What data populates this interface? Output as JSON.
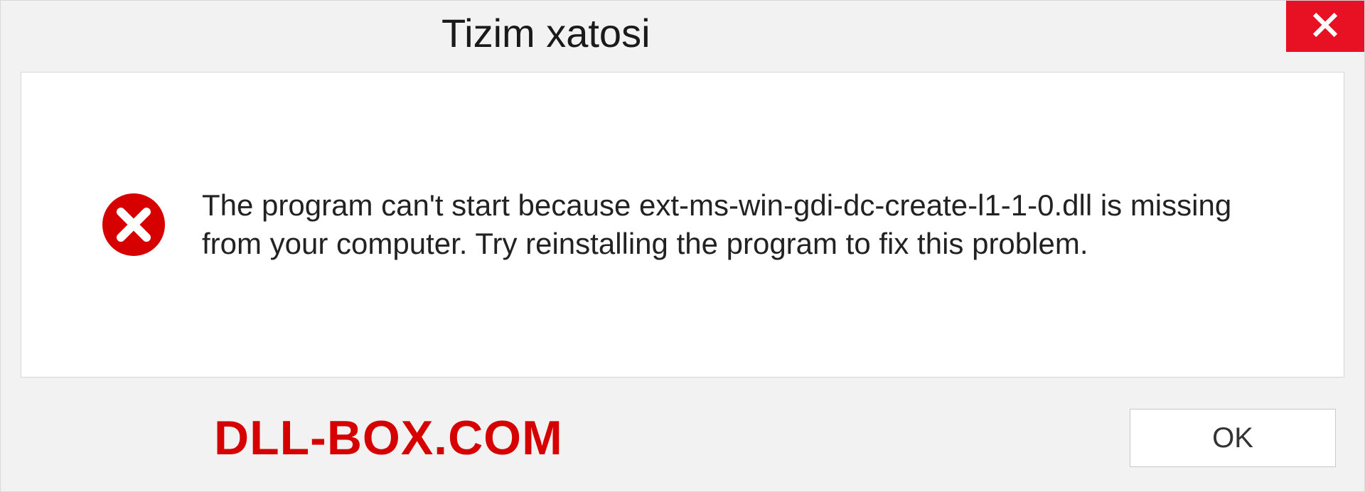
{
  "titlebar": {
    "title": "Tizim xatosi"
  },
  "content": {
    "message": "The program can't start because ext-ms-win-gdi-dc-create-l1-1-0.dll is missing from your computer. Try reinstalling the program to fix this problem."
  },
  "footer": {
    "watermark": "DLL-BOX.COM",
    "ok_label": "OK"
  }
}
